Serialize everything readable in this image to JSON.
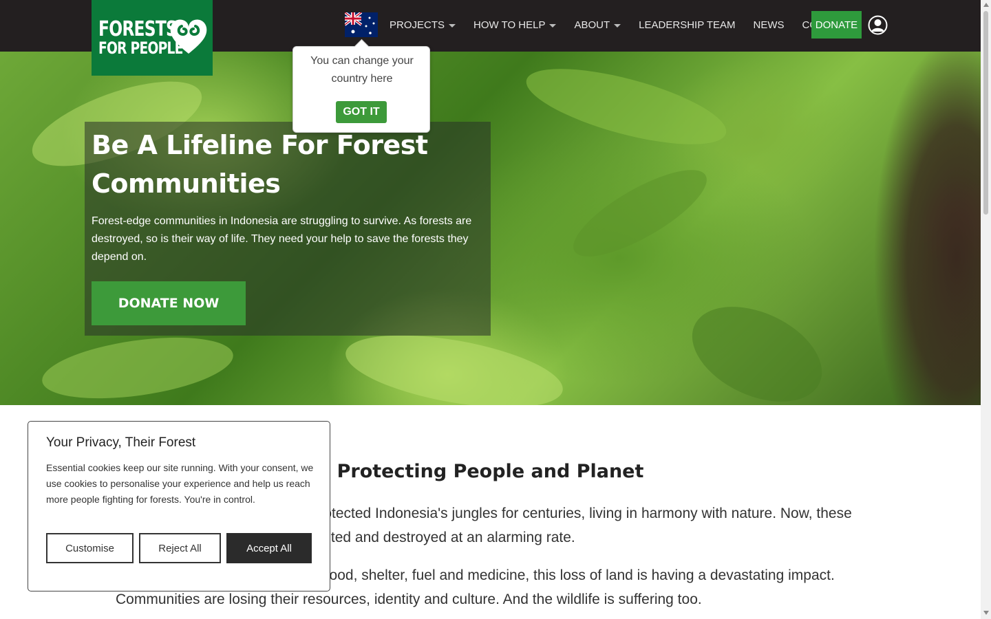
{
  "logo": {
    "line1": "FORESTS",
    "line2": "FOR PEOPLE"
  },
  "nav": {
    "items": [
      {
        "label": "PROJECTS",
        "has_dropdown": true
      },
      {
        "label": "HOW TO HELP",
        "has_dropdown": true
      },
      {
        "label": "ABOUT",
        "has_dropdown": true
      },
      {
        "label": "LEADERSHIP TEAM",
        "has_dropdown": false
      },
      {
        "label": "NEWS",
        "has_dropdown": false
      },
      {
        "label": "CONTACT",
        "has_dropdown": false
      }
    ],
    "donate_label": "DONATE",
    "country_icon": "australia-flag-icon",
    "account_icon": "user-account-icon"
  },
  "tooltip": {
    "text": "You can change your country here",
    "button_label": "GOT IT"
  },
  "hero": {
    "title": "Be A Lifeline For Forest Communities",
    "text": "Forest-edge communities in Indonesia are struggling to survive. As forests are destroyed, so is their way of life. They need your help to save the forests they depend on.",
    "cta_label": "DONATE NOW"
  },
  "main": {
    "title": "Protecting People and Planet",
    "para1": "Indigenous communities have protected Indonesia's jungles for centuries, living in harmony with nature. Now, these lands are being taken over, exploited and destroyed at an alarming rate.",
    "para2": "As they depend on the forest for food, shelter, fuel and medicine, this loss of land is having a devastating impact. Communities are losing their resources, identity and culture. And the wildlife is suffering too."
  },
  "cookie": {
    "title": "Your Privacy, Their Forest",
    "text": "Essential cookies keep our site running. With your consent, we use cookies to personalise your experience and help us reach more people fighting for forests. You're in control.",
    "customise_label": "Customise",
    "reject_label": "Reject All",
    "accept_label": "Accept All"
  },
  "colors": {
    "brand_green": "#0b7a3a",
    "button_green": "#3d9a3a",
    "topbar": "#231f20"
  }
}
